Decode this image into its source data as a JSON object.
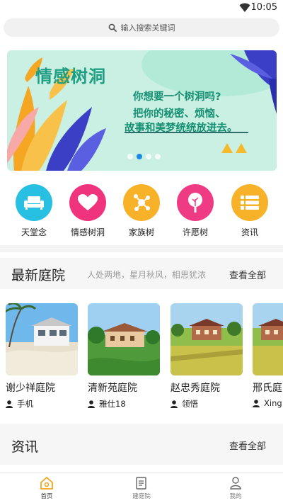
{
  "status_bar": {
    "time": "10:05"
  },
  "search": {
    "placeholder": "输入搜索关键词"
  },
  "banner": {
    "title": "情感树洞",
    "lines": [
      "你想要一个树洞吗?",
      "把你的秘密、烦恼、",
      "故事和美梦统统放进去。"
    ],
    "active_dot": 1,
    "dot_count": 4,
    "colors": {
      "background": "#c9f0e2",
      "accent": "#1f9e83"
    }
  },
  "quick_entries": [
    {
      "label": "天堂念",
      "icon": "sofa-icon",
      "color": "#27c0e3"
    },
    {
      "label": "情感树洞",
      "icon": "heart-icon",
      "color": "#f0337d"
    },
    {
      "label": "家族树",
      "icon": "network-icon",
      "color": "#f7b22a"
    },
    {
      "label": "许愿树",
      "icon": "tree-icon",
      "color": "#ef3b83"
    },
    {
      "label": "资讯",
      "icon": "list-icon",
      "color": "#f7b22a"
    }
  ],
  "latest_courts": {
    "title": "最新庭院",
    "subtitle": "人处两地，星月秋风，相思犹浓",
    "more": "查看全部",
    "items": [
      {
        "name": "谢少祥庭院",
        "owner": "手机"
      },
      {
        "name": "清新苑庭院",
        "owner": "雅仕18"
      },
      {
        "name": "赵忠秀庭院",
        "owner": "领悟"
      },
      {
        "name": "邢氏庭院",
        "owner": "Xing"
      }
    ]
  },
  "news": {
    "title": "资讯",
    "more": "查看全部"
  },
  "tabbar": {
    "items": [
      {
        "label": "首页",
        "icon": "home-icon",
        "active": true
      },
      {
        "label": "建庭院",
        "icon": "document-icon",
        "active": false
      },
      {
        "label": "我的",
        "icon": "user-icon",
        "active": false
      }
    ]
  }
}
